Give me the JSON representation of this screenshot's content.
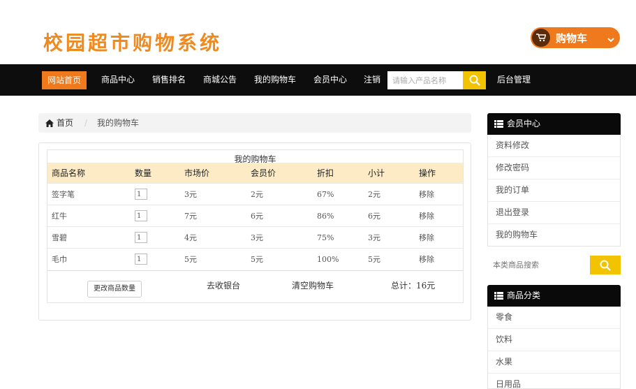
{
  "header": {
    "site_title": "校园超市购物系统",
    "cart_button": "购物车"
  },
  "nav": {
    "items": [
      "网站首页",
      "商品中心",
      "销售排名",
      "商城公告",
      "我的购物车",
      "会员中心",
      "注销"
    ],
    "search_placeholder": "请输入产品名称",
    "admin": "后台管理"
  },
  "breadcrumb": {
    "home": "首页",
    "current": "我的购物车"
  },
  "cart": {
    "caption": "我的购物车",
    "columns": [
      "商品名称",
      "数量",
      "市场价",
      "会员价",
      "折扣",
      "小计",
      "操作"
    ],
    "rows": [
      {
        "name": "签字笔",
        "qty": "1",
        "market": "3元",
        "member": "2元",
        "discount": "67%",
        "subtotal": "2元",
        "action": "移除"
      },
      {
        "name": "红牛",
        "qty": "1",
        "market": "7元",
        "member": "6元",
        "discount": "86%",
        "subtotal": "6元",
        "action": "移除"
      },
      {
        "name": "雪碧",
        "qty": "1",
        "market": "4元",
        "member": "3元",
        "discount": "75%",
        "subtotal": "3元",
        "action": "移除"
      },
      {
        "name": "毛巾",
        "qty": "1",
        "market": "5元",
        "member": "5元",
        "discount": "100%",
        "subtotal": "5元",
        "action": "移除"
      }
    ],
    "update_button": "更改商品数量",
    "checkout": "去收银台",
    "clear": "清空购物车",
    "total": "总计：16元"
  },
  "sidebar": {
    "member_title": "会员中心",
    "member_items": [
      "资料修改",
      "修改密码",
      "我的订单",
      "退出登录",
      "我的购物车"
    ],
    "search_placeholder": "本类商品搜索",
    "category_title": "商品分类",
    "categories": [
      "零食",
      "饮料",
      "水果",
      "日用品"
    ]
  },
  "colors": {
    "accent": "#ef7a1d",
    "nav_bg": "#0d0d0d",
    "search_btn": "#f2c300",
    "table_head": "#fcebc4"
  }
}
